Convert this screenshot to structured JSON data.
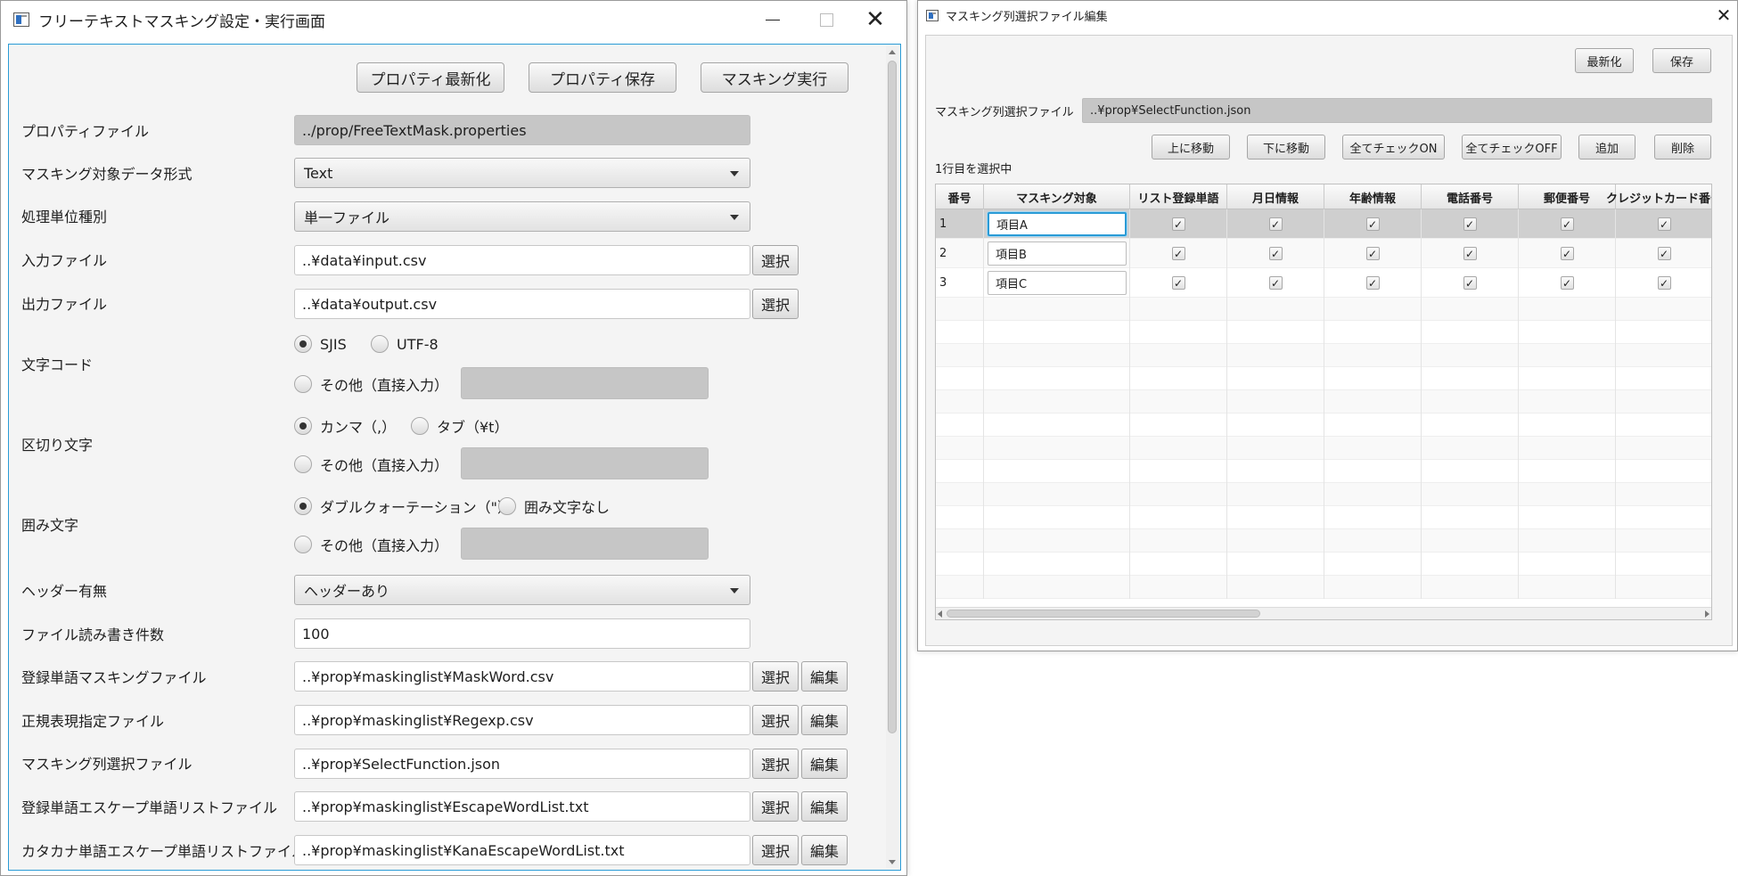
{
  "main_window": {
    "title": "フリーテキストマスキング設定・実行画面",
    "close_glyph": "✕",
    "buttons": {
      "refresh_properties": "プロパティ最新化",
      "save_properties": "プロパティ保存",
      "run_masking": "マスキング実行"
    },
    "labels": {
      "property_file": "プロパティファイル",
      "target_format": "マスキング対象データ形式",
      "processing_unit": "処理単位種別",
      "input_file": "入力ファイル",
      "output_file": "出力ファイル",
      "charset": "文字コード",
      "delimiter": "区切り文字",
      "enclosure": "囲み文字",
      "header": "ヘッダー有無",
      "io_count": "ファイル読み書き件数",
      "word_mask_file": "登録単語マスキングファイル",
      "regex_file": "正規表現指定ファイル",
      "column_select_file": "マスキング列選択ファイル",
      "escape_word_file": "登録単語エスケープ単語リストファイル",
      "kana_escape_file": "カタカナ単語エスケープ単語リストファイル"
    },
    "values": {
      "property_file": "../prop/FreeTextMask.properties",
      "target_format": "Text",
      "processing_unit": "単一ファイル",
      "input_file": "..¥data¥input.csv",
      "output_file": "..¥data¥output.csv",
      "header": "ヘッダーあり",
      "io_count": "100",
      "word_mask_file": "..¥prop¥maskinglist¥MaskWord.csv",
      "regex_file": "..¥prop¥maskinglist¥Regexp.csv",
      "column_select_file": "..¥prop¥SelectFunction.json",
      "escape_word_file": "..¥prop¥maskinglist¥EscapeWordList.txt",
      "kana_escape_file": "..¥prop¥maskinglist¥KanaEscapeWordList.txt"
    },
    "radios": {
      "charset": {
        "opt1": "SJIS",
        "opt2": "UTF-8",
        "other": "その他（直接入力）",
        "selected": "SJIS"
      },
      "delimiter": {
        "opt1": "カンマ（,）",
        "opt2": "タブ（¥t）",
        "other": "その他（直接入力）",
        "selected": "カンマ（,）"
      },
      "enclosure": {
        "opt1": "ダブルクォーテーション（\"）",
        "opt2": "囲み文字なし",
        "other": "その他（直接入力）",
        "selected": "ダブルクォーテーション（\"）"
      }
    },
    "small_buttons": {
      "select": "選択",
      "edit": "編集"
    }
  },
  "sub_window": {
    "title": "マスキング列選択ファイル編集",
    "close_glyph": "✕",
    "buttons": {
      "refresh": "最新化",
      "save": "保存",
      "move_up": "上に移動",
      "move_down": "下に移動",
      "check_all_on": "全てチェックON",
      "check_all_off": "全てチェックOFF",
      "add": "追加",
      "delete": "削除"
    },
    "file_label": "マスキング列選択ファイル",
    "file_value": "..¥prop¥SelectFunction.json",
    "status": "1行目を選択中",
    "table": {
      "columns": [
        "番号",
        "マスキング対象",
        "リスト登録単語",
        "月日情報",
        "年齢情報",
        "電話番号",
        "郵便番号",
        "クレジットカード番号"
      ],
      "rows": [
        {
          "num": "1",
          "target": "項目A",
          "checks": [
            true,
            true,
            true,
            true,
            true,
            true
          ]
        },
        {
          "num": "2",
          "target": "項目B",
          "checks": [
            true,
            true,
            true,
            true,
            true,
            true
          ]
        },
        {
          "num": "3",
          "target": "項目C",
          "checks": [
            true,
            true,
            true,
            true,
            true,
            true
          ]
        }
      ],
      "selected_row": 1,
      "check_glyph": "✓"
    }
  }
}
